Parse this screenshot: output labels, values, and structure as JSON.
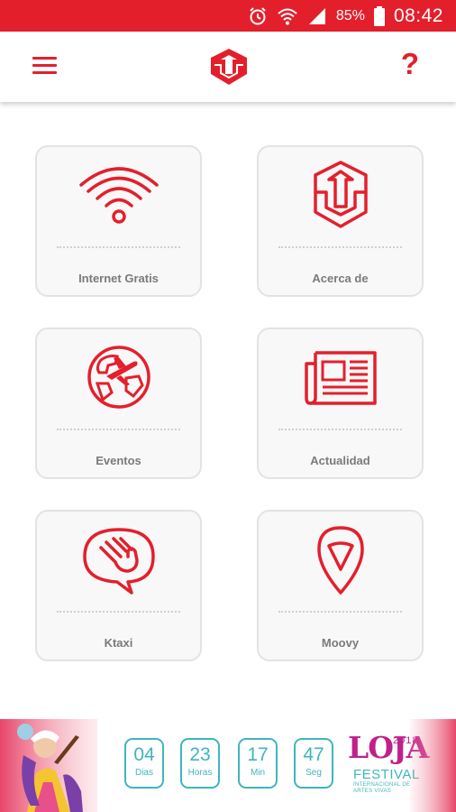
{
  "status_bar": {
    "battery": "85%",
    "time": "08:42",
    "icons": [
      "alarm-icon",
      "wifi-icon",
      "signal-icon",
      "battery-icon"
    ]
  },
  "app_bar": {
    "menu_icon": "hamburger-menu-icon",
    "logo_icon": "app-logo-icon",
    "help_label": "?"
  },
  "cards": [
    {
      "label": "Internet Gratis",
      "icon": "wifi-icon"
    },
    {
      "label": "Acerca de",
      "icon": "app-logo-icon"
    },
    {
      "label": "Eventos",
      "icon": "globe-plane-icon"
    },
    {
      "label": "Actualidad",
      "icon": "newspaper-icon"
    },
    {
      "label": "Ktaxi",
      "icon": "hand-speech-bubble-icon"
    },
    {
      "label": "Moovy",
      "icon": "location-pin-icon"
    }
  ],
  "countdown": {
    "days": {
      "value": "04",
      "unit": "Dias"
    },
    "hours": {
      "value": "23",
      "unit": "Horas"
    },
    "minutes": {
      "value": "17",
      "unit": "Min"
    },
    "seconds": {
      "value": "47",
      "unit": "Seg"
    }
  },
  "festival": {
    "logo": "LOJA",
    "year": "2018",
    "name": "FESTIVAL",
    "subtitle": "INTERNACIONAL DE ARTES VIVAS"
  },
  "colors": {
    "accent": "#e41f2c",
    "teal": "#40b5bd",
    "magenta": "#c0208a"
  }
}
